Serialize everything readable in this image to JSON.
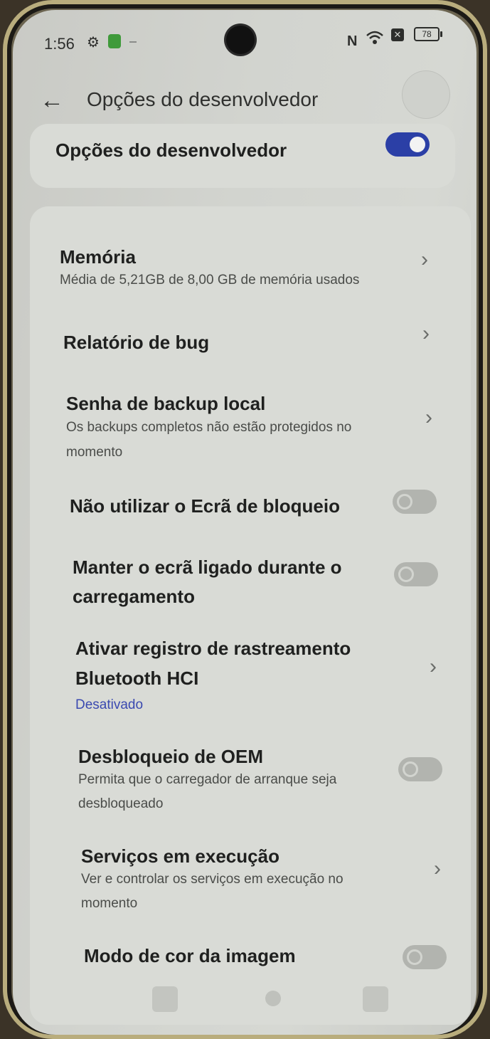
{
  "status_bar": {
    "time": "1:56",
    "left_icons": [
      "gear-icon",
      "android-robot-icon",
      "minus-icon"
    ],
    "right_icons": [
      "nfc-icon",
      "wifi-icon",
      "sim-x-icon"
    ],
    "battery": "78"
  },
  "header": {
    "title": "Opções do desenvolvedor"
  },
  "master_toggle": {
    "label": "Opções do desenvolvedor",
    "on": true
  },
  "settings": [
    {
      "title": "Memória",
      "subtitle": "Média de 5,21GB de 8,00 GB de memória usados",
      "control": "chevron"
    },
    {
      "title": "Relatório de bug",
      "control": "chevron"
    },
    {
      "title": "Senha de backup local",
      "subtitle_line1": "Os backups completos não estão protegidos no",
      "subtitle_line2": "momento",
      "control": "chevron"
    },
    {
      "title": "Não utilizar o Ecrã de bloqueio",
      "control": "toggle",
      "on": false
    },
    {
      "title_line1": "Manter o ecrã ligado durante o",
      "title_line2": "carregamento",
      "control": "toggle",
      "on": false
    },
    {
      "title_line1": "Ativar registro de rastreamento",
      "title_line2": "Bluetooth HCI",
      "subtitle": "Desativado",
      "control": "chevron"
    },
    {
      "title": "Desbloqueio de OEM",
      "subtitle_line1": "Permita que o carregador de arranque seja",
      "subtitle_line2": "desbloqueado",
      "control": "toggle",
      "on": false
    },
    {
      "title": "Serviços em execução",
      "subtitle_line1": "Ver e controlar os serviços em execução no",
      "subtitle_line2": "momento",
      "control": "chevron"
    },
    {
      "title": "Modo de cor da imagem",
      "control": "toggle",
      "on": false
    }
  ],
  "colors": {
    "accent": "#2b3fa6",
    "background": "#d2d4cf",
    "card": "#d9dbd6"
  }
}
